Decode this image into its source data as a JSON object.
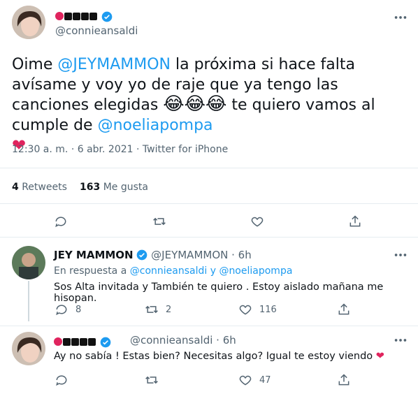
{
  "main_tweet": {
    "author_display_glyphs": "◉ ▪ ▪ ▪",
    "handle": "@connieansaldi",
    "text_before": "Oime ",
    "mention1": "@JEYMAMMON",
    "text_mid": " la próxima si hace falta avísame y voy yo de raje que ya tengo las canciones elegidas",
    "emojis": "😂😂😂",
    "text_after": " te quiero vamos al cumple de ",
    "mention2": "@noeliapompa",
    "heart": "❤",
    "meta": "12:30 a. m. · 6 abr. 2021 · Twitter for iPhone",
    "retweets_count": "4",
    "retweets_label": "Retweets",
    "likes_count": "163",
    "likes_label": "Me gusta"
  },
  "reply1": {
    "name": "JEY MAMMON",
    "handle": "@JEYMAMMON · 6h",
    "replying_prefix": "En respuesta a ",
    "replying_mentions": "@connieansaldi y @noeliapompa",
    "text": "Sos Alta invitada y También  te quiero . Estoy aislado mañana me hisopan.",
    "reply_count": "8",
    "retweet_count": "2",
    "like_count": "116"
  },
  "reply2": {
    "handle": "@connieansaldi · 6h",
    "text": "Ay no sabía ! Estas bien? Necesitas algo? Igual te estoy viendo ",
    "heart": "❤",
    "like_count": "47"
  },
  "colors": {
    "accent": "#1d9bf0",
    "heart": "#e0245e",
    "text": "#0f1419",
    "muted": "#536471"
  }
}
